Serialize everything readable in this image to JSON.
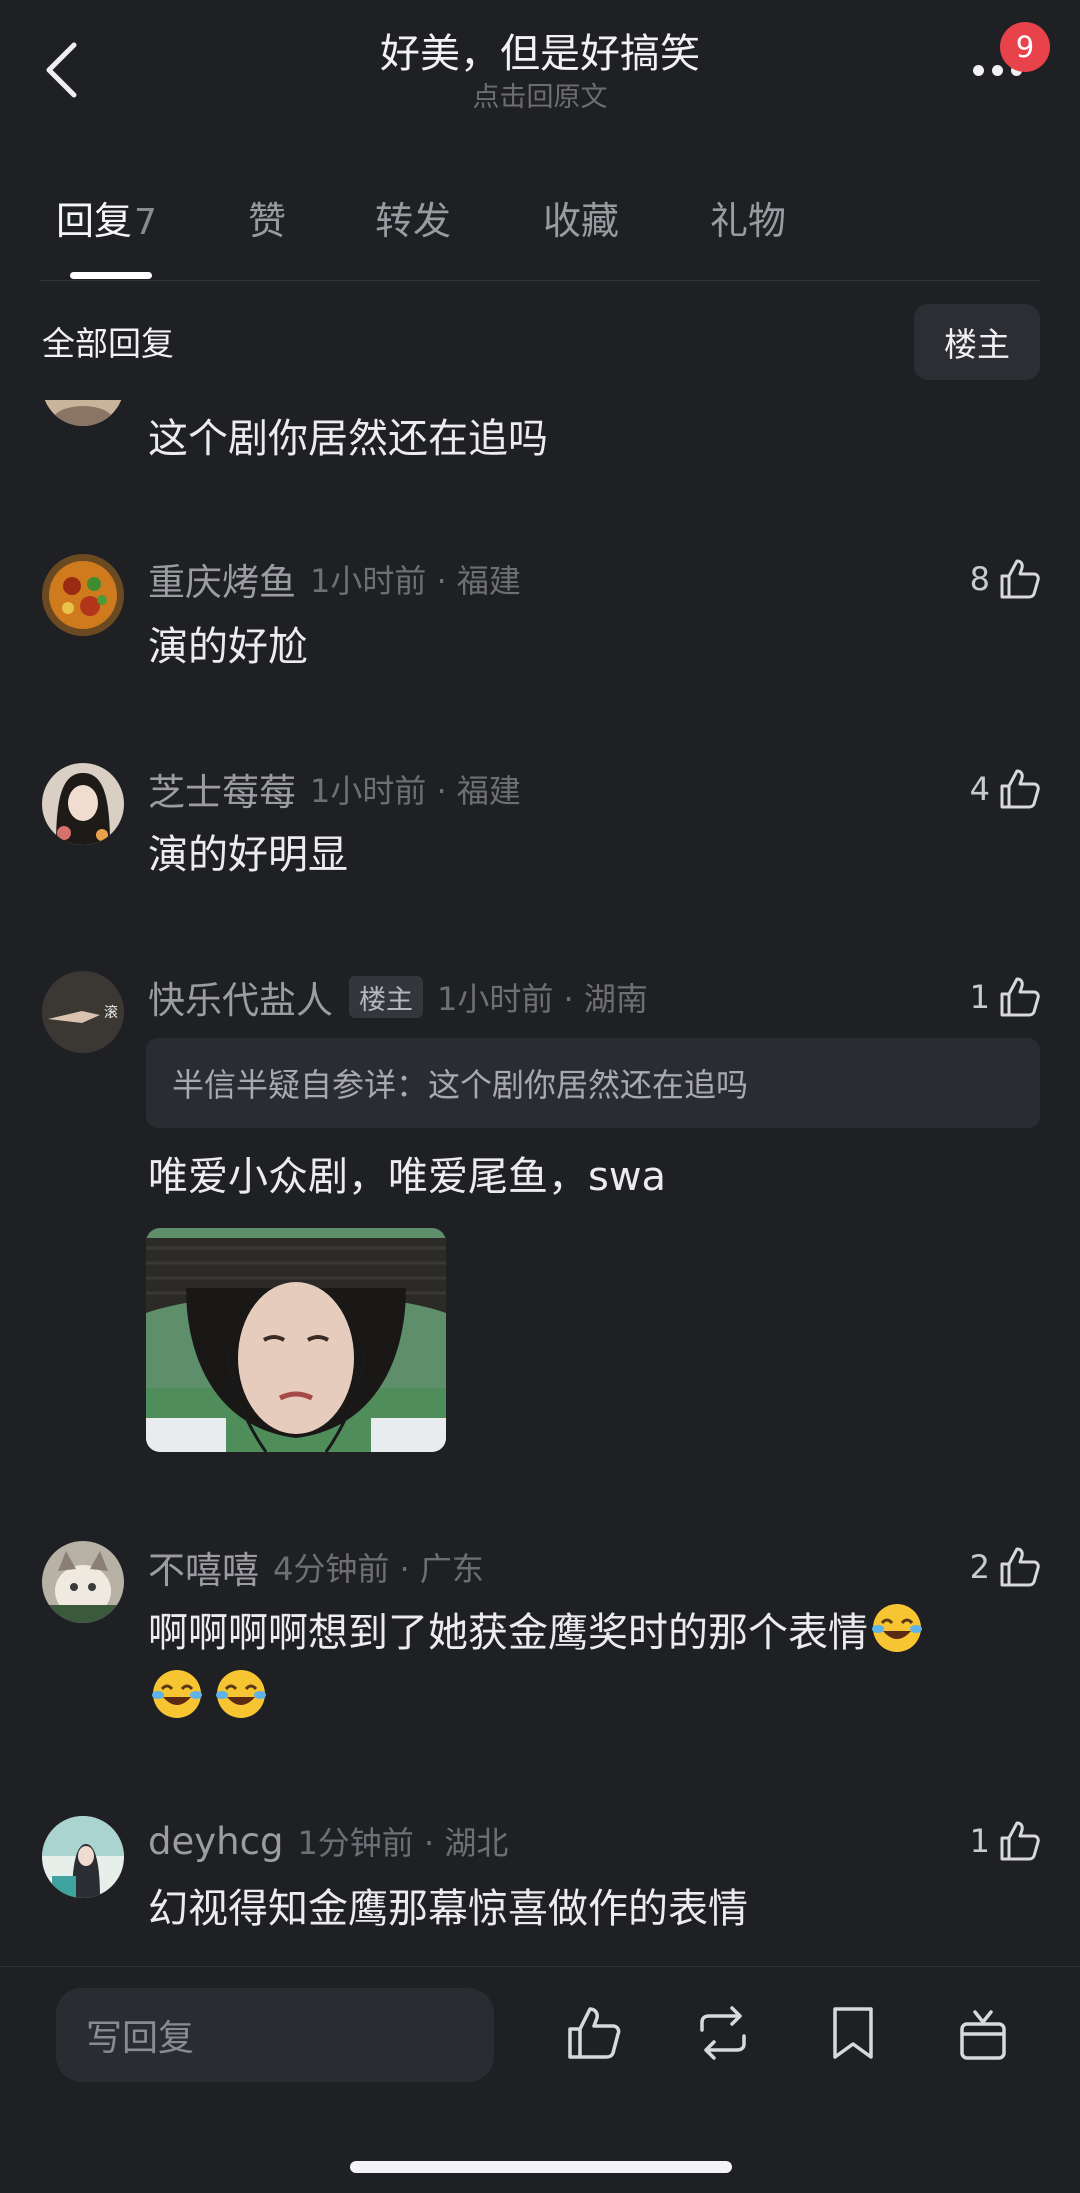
{
  "header": {
    "title": "好美，但是好搞笑",
    "subtitle": "点击回原文",
    "notification_count": "9"
  },
  "tabs": [
    {
      "label": "回复",
      "count": "7",
      "active": true
    },
    {
      "label": "赞",
      "count": "",
      "active": false
    },
    {
      "label": "转发",
      "count": "",
      "active": false
    },
    {
      "label": "收藏",
      "count": "",
      "active": false
    },
    {
      "label": "礼物",
      "count": "",
      "active": false
    }
  ],
  "filter": {
    "all_replies_label": "全部回复",
    "op_only_label": "楼主"
  },
  "comments": [
    {
      "text": "这个剧你居然还在追吗"
    },
    {
      "username": "重庆烤鱼",
      "time_location": "1小时前 · 福建",
      "likes": "8",
      "text": "演的好尬"
    },
    {
      "username": "芝士莓莓",
      "time_location": "1小时前 · 福建",
      "likes": "4",
      "text": "演的好明显"
    },
    {
      "username": "快乐代盐人",
      "badge": "楼主",
      "avatar_text": "滚",
      "time_location": "1小时前 · 湖南",
      "likes": "1",
      "quote": "半信半疑自参详：这个剧你居然还在追吗",
      "text": "唯爱小众剧，唯爱尾鱼，swa"
    },
    {
      "username": "不嘻嘻",
      "time_location": "4分钟前 · 广东",
      "likes": "2",
      "text_line1": "啊啊啊啊想到了她获金鹰奖时的那个表情",
      "emoji": "laugh-cry"
    },
    {
      "username": "deyhcg",
      "time_location": "1分钟前 · 湖北",
      "likes": "1",
      "text": "幻视得知金鹰那幕惊喜做作的表情"
    }
  ],
  "bottom_bar": {
    "reply_placeholder": "写回复",
    "icons": [
      "thumb-up-icon",
      "repost-icon",
      "bookmark-icon",
      "gift-icon"
    ]
  },
  "colors": {
    "background": "#1f2024",
    "badge_red": "#e8424a",
    "text_primary": "#ececee",
    "text_secondary": "#9c9da3"
  }
}
